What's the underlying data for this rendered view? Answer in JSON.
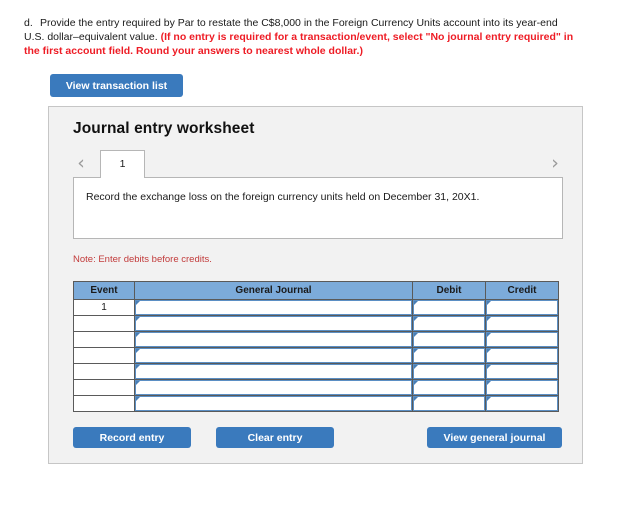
{
  "question": {
    "letter": "d.",
    "text_before": "Provide the entry required by Par to restate the C$8,000 in the Foreign Currency Units account into its year-end U.S. dollar–equivalent value. ",
    "text_red": "(If no entry is required for a transaction/event, select \"No journal entry required\" in the first account field. Round your answers to nearest whole dollar.)"
  },
  "toolbar": {
    "view_transaction_list_label": "View transaction list"
  },
  "panel": {
    "title": "Journal entry worksheet",
    "tabs": {
      "prev_arrow": "‹",
      "next_arrow": "›",
      "items": [
        {
          "label": "1",
          "active": true
        }
      ]
    },
    "instruction": "Record the exchange loss on the foreign currency units held on December 31, 20X1.",
    "note": "Note: Enter debits before credits."
  },
  "journal_table": {
    "columns": [
      "Event",
      "General Journal",
      "Debit",
      "Credit"
    ],
    "rows": [
      {
        "event": "1",
        "general_journal": "",
        "debit": "",
        "credit": ""
      },
      {
        "event": "",
        "general_journal": "",
        "debit": "",
        "credit": ""
      },
      {
        "event": "",
        "general_journal": "",
        "debit": "",
        "credit": ""
      },
      {
        "event": "",
        "general_journal": "",
        "debit": "",
        "credit": ""
      },
      {
        "event": "",
        "general_journal": "",
        "debit": "",
        "credit": ""
      },
      {
        "event": "",
        "general_journal": "",
        "debit": "",
        "credit": ""
      },
      {
        "event": "",
        "general_journal": "",
        "debit": "",
        "credit": ""
      }
    ]
  },
  "footer": {
    "record_entry_label": "Record entry",
    "clear_entry_label": "Clear entry",
    "view_general_journal_label": "View general journal"
  },
  "colors": {
    "button_blue": "#3a7abd",
    "table_header_blue": "#7cabda",
    "note_red": "#c23b3b",
    "question_red": "#ee1c25",
    "panel_bg": "#f2f2f2",
    "panel_border": "#c6c6c6",
    "input_border_blue": "#5b8fc4"
  }
}
